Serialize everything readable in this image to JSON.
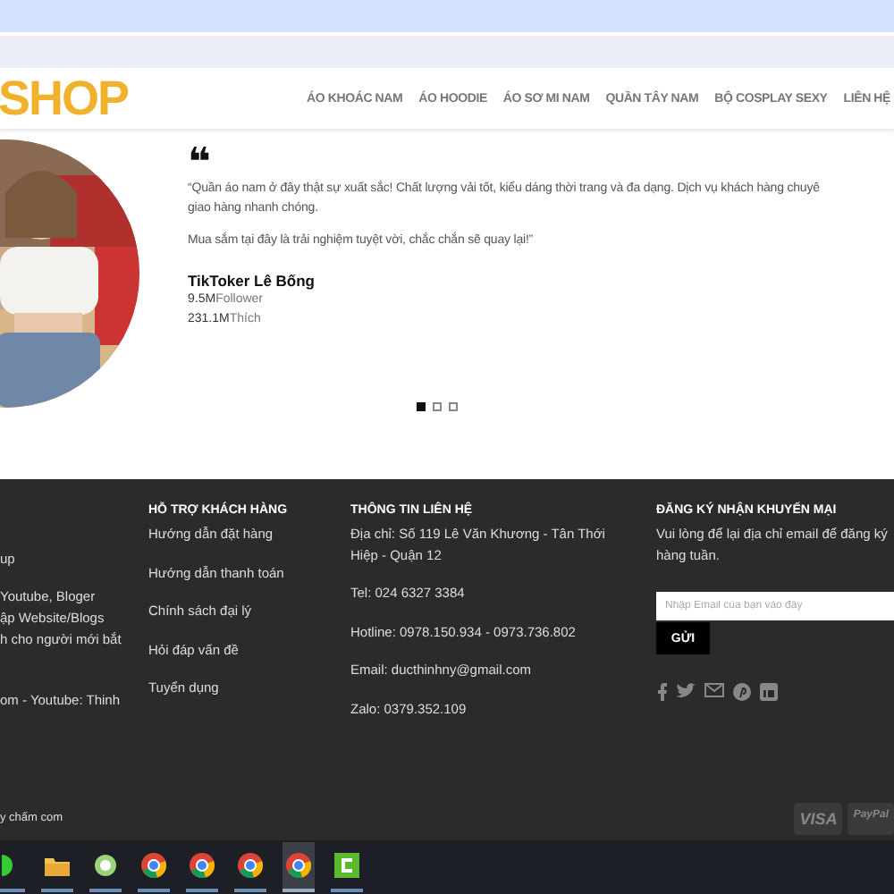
{
  "header": {
    "logo": "SHOP",
    "nav": [
      {
        "label": "ÁO KHOÁC NAM"
      },
      {
        "label": "ÁO HOODIE"
      },
      {
        "label": "ÁO SƠ MI NAM"
      },
      {
        "label": "QUẦN TÂY NAM"
      },
      {
        "label": "BỘ COSPLAY SEXY"
      },
      {
        "label": "LIÊN HỆ"
      }
    ]
  },
  "testimonial": {
    "photo": {
      "kind": "picture"
    },
    "quote_mark": "❝",
    "lines": [
      "“Quần áo nam ở đây thật sự xuất sắc! Chất lượng vải tốt, kiểu dáng thời trang và đa dạng. Dịch vụ khách hàng chuyê",
      "giao hàng nhanh chóng."
    ],
    "closing": "Mua sắm tại đây là trải nghiệm tuyệt vời, chắc chắn sẽ quay lại!”",
    "author": "TikToker Lê Bống",
    "stats": [
      {
        "value": "9.5M",
        "unit": "Follower"
      },
      {
        "value": "231.1M",
        "unit": "Thích"
      }
    ],
    "dots": [
      {
        "selected": true
      },
      {
        "selected": false
      },
      {
        "selected": false
      }
    ]
  },
  "footer": {
    "column_1": [
      "up",
      "Youtube, Bloger",
      "ập Website/Blogs",
      "h cho người mới bắt",
      "om - Youtube: Thinh"
    ],
    "support": {
      "title": "HỖ TRỢ KHÁCH HÀNG",
      "links": [
        "Hướng dẫn đặt hàng",
        "Hướng dẫn thanh toán",
        "Chính sách đại lý",
        "Hỏi đáp vấn đề",
        "Tuyển dụng"
      ]
    },
    "contact": {
      "title": "THÔNG TIN LIÊN HỆ",
      "address": [
        "Địa chỉ: Số 119 Lê Văn Khương - Tân Thới",
        "Hiệp - Quận 12"
      ],
      "items": [
        "Tel: 024 6327 3384",
        "Hotline: 0978.150.934 - 0973.736.802",
        "Email: ducthinhny@gmail.com",
        "Zalo: 0379.352.109"
      ]
    },
    "newsletter": {
      "title": "ĐĂNG KÝ NHẬN KHUYẾN MẠI",
      "text": [
        "Vui lòng để lại địa chỉ email để đăng ký",
        "hàng tuần."
      ],
      "placeholder": "Nhập Email của bạn vào đây",
      "button": "GỬI",
      "social": [
        {
          "kind": "facebook"
        },
        {
          "kind": "twitter"
        },
        {
          "kind": "email"
        },
        {
          "kind": "pinterest"
        },
        {
          "kind": "linkedin"
        }
      ]
    },
    "copyright": "y chấm com",
    "payments": [
      "VISA",
      "PayPal"
    ]
  },
  "taskbar": {
    "apps": [
      {
        "kind": "start"
      },
      {
        "kind": "folder"
      },
      {
        "kind": "ring"
      },
      {
        "kind": "browser"
      },
      {
        "kind": "browser"
      },
      {
        "kind": "browser"
      },
      {
        "kind": "browser",
        "selected": true
      },
      {
        "kind": "editor"
      }
    ]
  }
}
